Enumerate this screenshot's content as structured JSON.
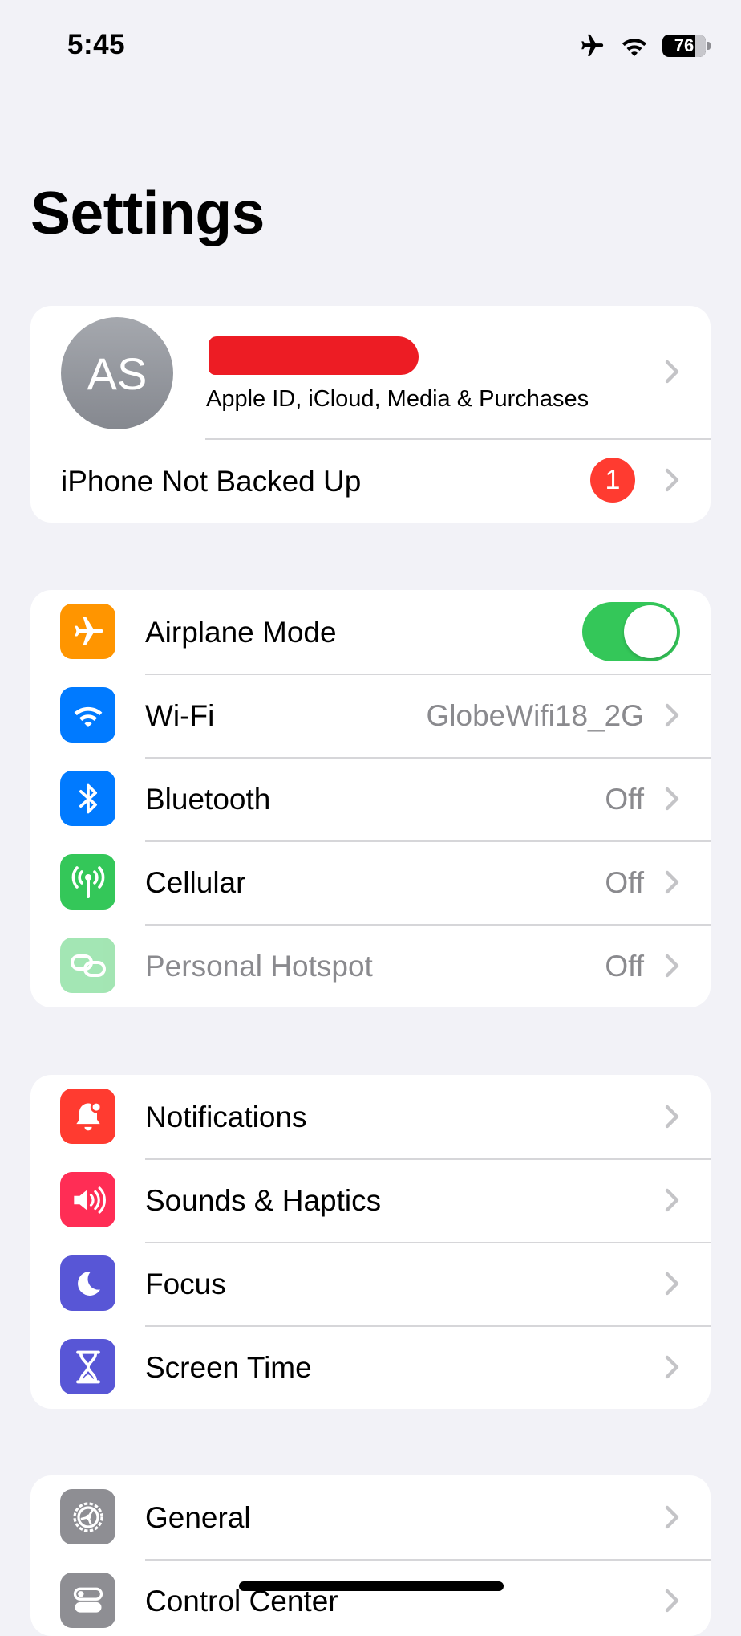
{
  "status_bar": {
    "time": "5:45",
    "battery_level": "76",
    "airplane_mode": true
  },
  "page_title": "Settings",
  "account": {
    "initials": "AS",
    "subtitle": "Apple ID, iCloud, Media & Purchases",
    "backup_label": "iPhone Not Backed Up",
    "backup_badge": "1"
  },
  "connectivity": {
    "airplane": {
      "label": "Airplane Mode",
      "icon": "airplane-icon",
      "color": "#ff9500",
      "on": true
    },
    "wifi": {
      "label": "Wi-Fi",
      "value": "GlobeWifi18_2G",
      "icon": "wifi-icon",
      "color": "#007aff"
    },
    "bluetooth": {
      "label": "Bluetooth",
      "value": "Off",
      "icon": "bluetooth-icon",
      "color": "#007aff"
    },
    "cellular": {
      "label": "Cellular",
      "value": "Off",
      "icon": "cellular-antenna-icon",
      "color": "#34c759"
    },
    "hotspot": {
      "label": "Personal Hotspot",
      "value": "Off",
      "icon": "hotspot-link-icon",
      "color": "#34c759",
      "disabled": true
    }
  },
  "notifications_group": {
    "notifications": {
      "label": "Notifications",
      "icon": "bell-icon",
      "color": "#ff3b30"
    },
    "sounds": {
      "label": "Sounds & Haptics",
      "icon": "speaker-icon",
      "color": "#ff2d55"
    },
    "focus": {
      "label": "Focus",
      "icon": "moon-icon",
      "color": "#5856d6"
    },
    "screen_time": {
      "label": "Screen Time",
      "icon": "hourglass-icon",
      "color": "#5856d6"
    }
  },
  "general_group": {
    "general": {
      "label": "General",
      "icon": "gear-icon",
      "color": "#8e8e93"
    },
    "control_center": {
      "label": "Control Center",
      "icon": "toggles-icon",
      "color": "#8e8e93"
    }
  }
}
